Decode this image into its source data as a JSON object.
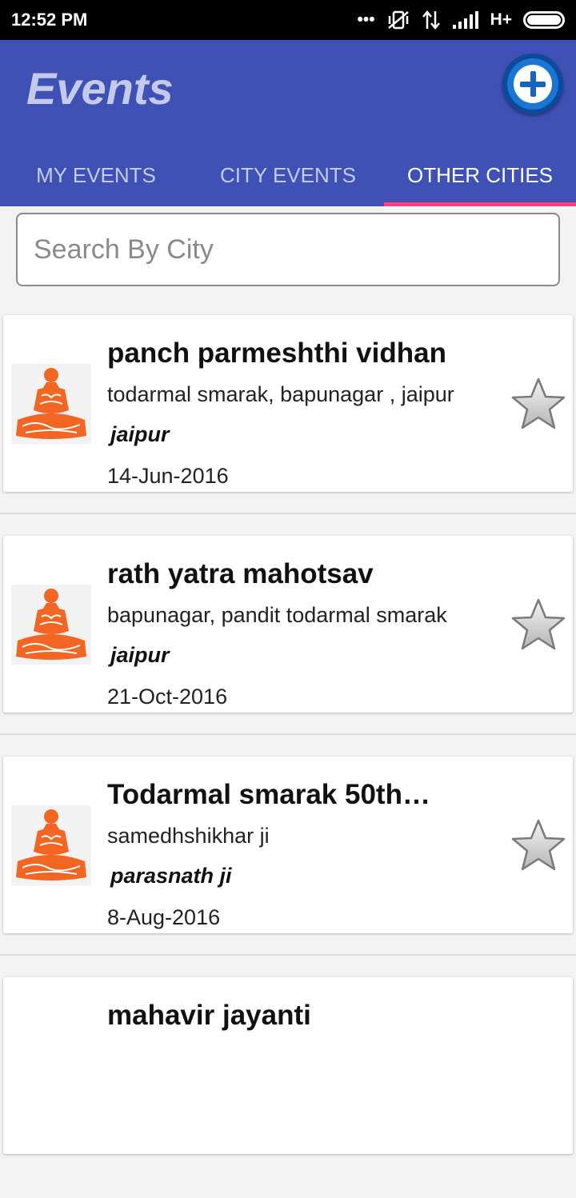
{
  "status_bar": {
    "time": "12:52 PM",
    "network": "H+"
  },
  "app_bar": {
    "title": "Events"
  },
  "tabs": [
    {
      "label": "MY EVENTS",
      "active": false
    },
    {
      "label": "CITY EVENTS",
      "active": false
    },
    {
      "label": "OTHER CITIES",
      "active": true
    }
  ],
  "search": {
    "placeholder": "Search By City",
    "value": ""
  },
  "events": [
    {
      "title": "panch parmeshthi vidhan",
      "address": "todarmal smarak, bapunagar , jaipur",
      "city": "jaipur",
      "date": "14-Jun-2016"
    },
    {
      "title": "rath yatra mahotsav",
      "address": "bapunagar, pandit todarmal smarak",
      "city": "jaipur",
      "date": "21-Oct-2016"
    },
    {
      "title": "Todarmal smarak 50th…",
      "address": "samedhshikhar ji",
      "city": "parasnath ji",
      "date": "8-Aug-2016"
    },
    {
      "title": "mahavir jayanti",
      "address": "",
      "city": "",
      "date": ""
    }
  ],
  "colors": {
    "primary": "#3f51b5",
    "accent": "#ff4081",
    "thumb_orange": "#f26522"
  }
}
